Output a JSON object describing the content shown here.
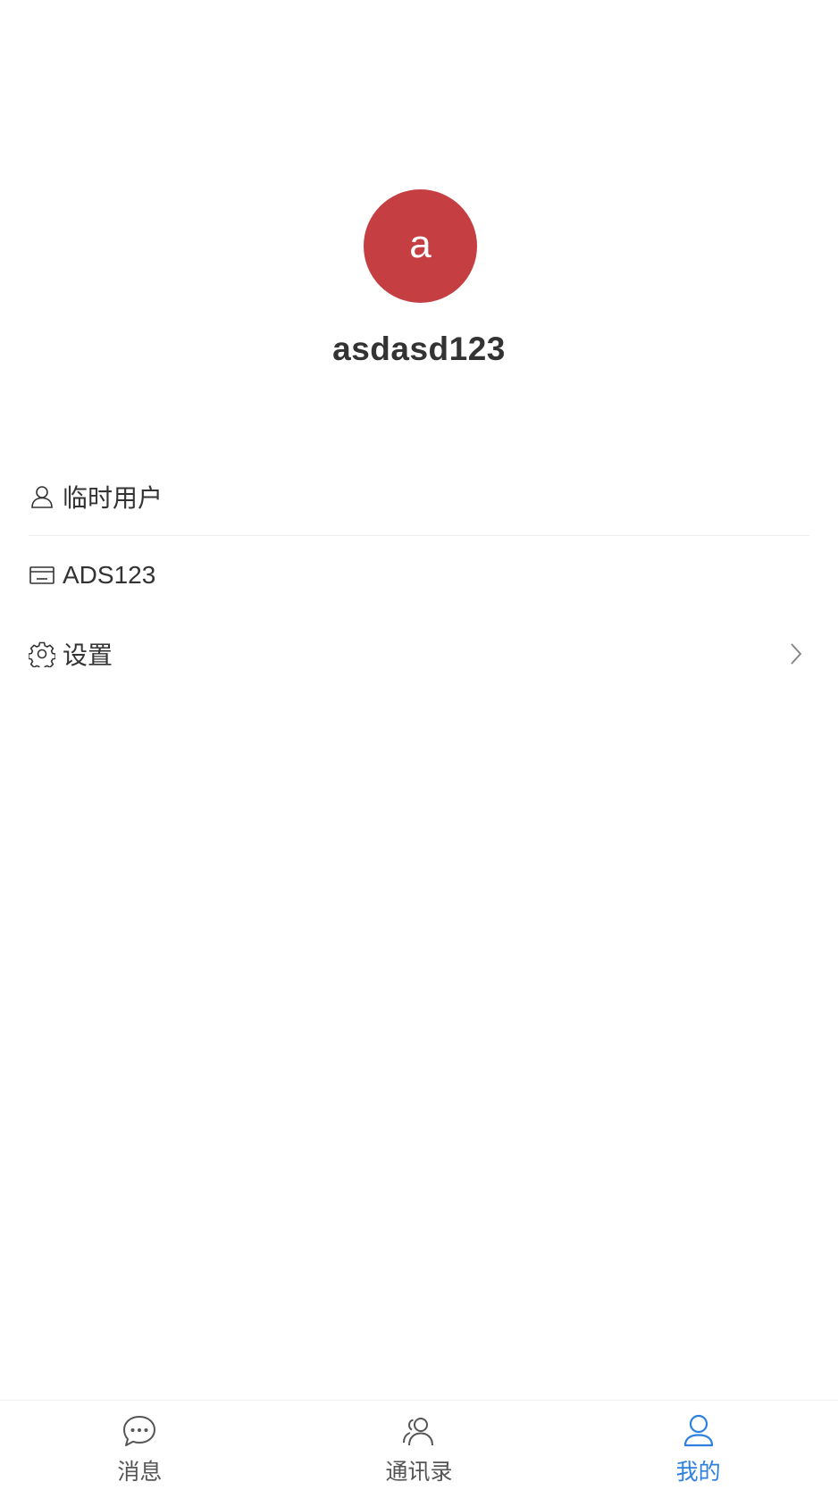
{
  "profile": {
    "avatar_letter": "a",
    "avatar_color": "#c43e42",
    "username": "asdasd123"
  },
  "menu": {
    "items": [
      {
        "icon": "user-icon",
        "label": "临时用户"
      },
      {
        "icon": "card-icon",
        "label": "ADS123"
      },
      {
        "icon": "gear-icon",
        "label": "设置",
        "has_arrow": true
      }
    ]
  },
  "tabbar": {
    "active_color": "#2d7fe0",
    "tabs": [
      {
        "icon": "chat-bubble-icon",
        "label": "消息",
        "active": false
      },
      {
        "icon": "contacts-icon",
        "label": "通讯录",
        "active": false
      },
      {
        "icon": "person-icon",
        "label": "我的",
        "active": true
      }
    ]
  }
}
